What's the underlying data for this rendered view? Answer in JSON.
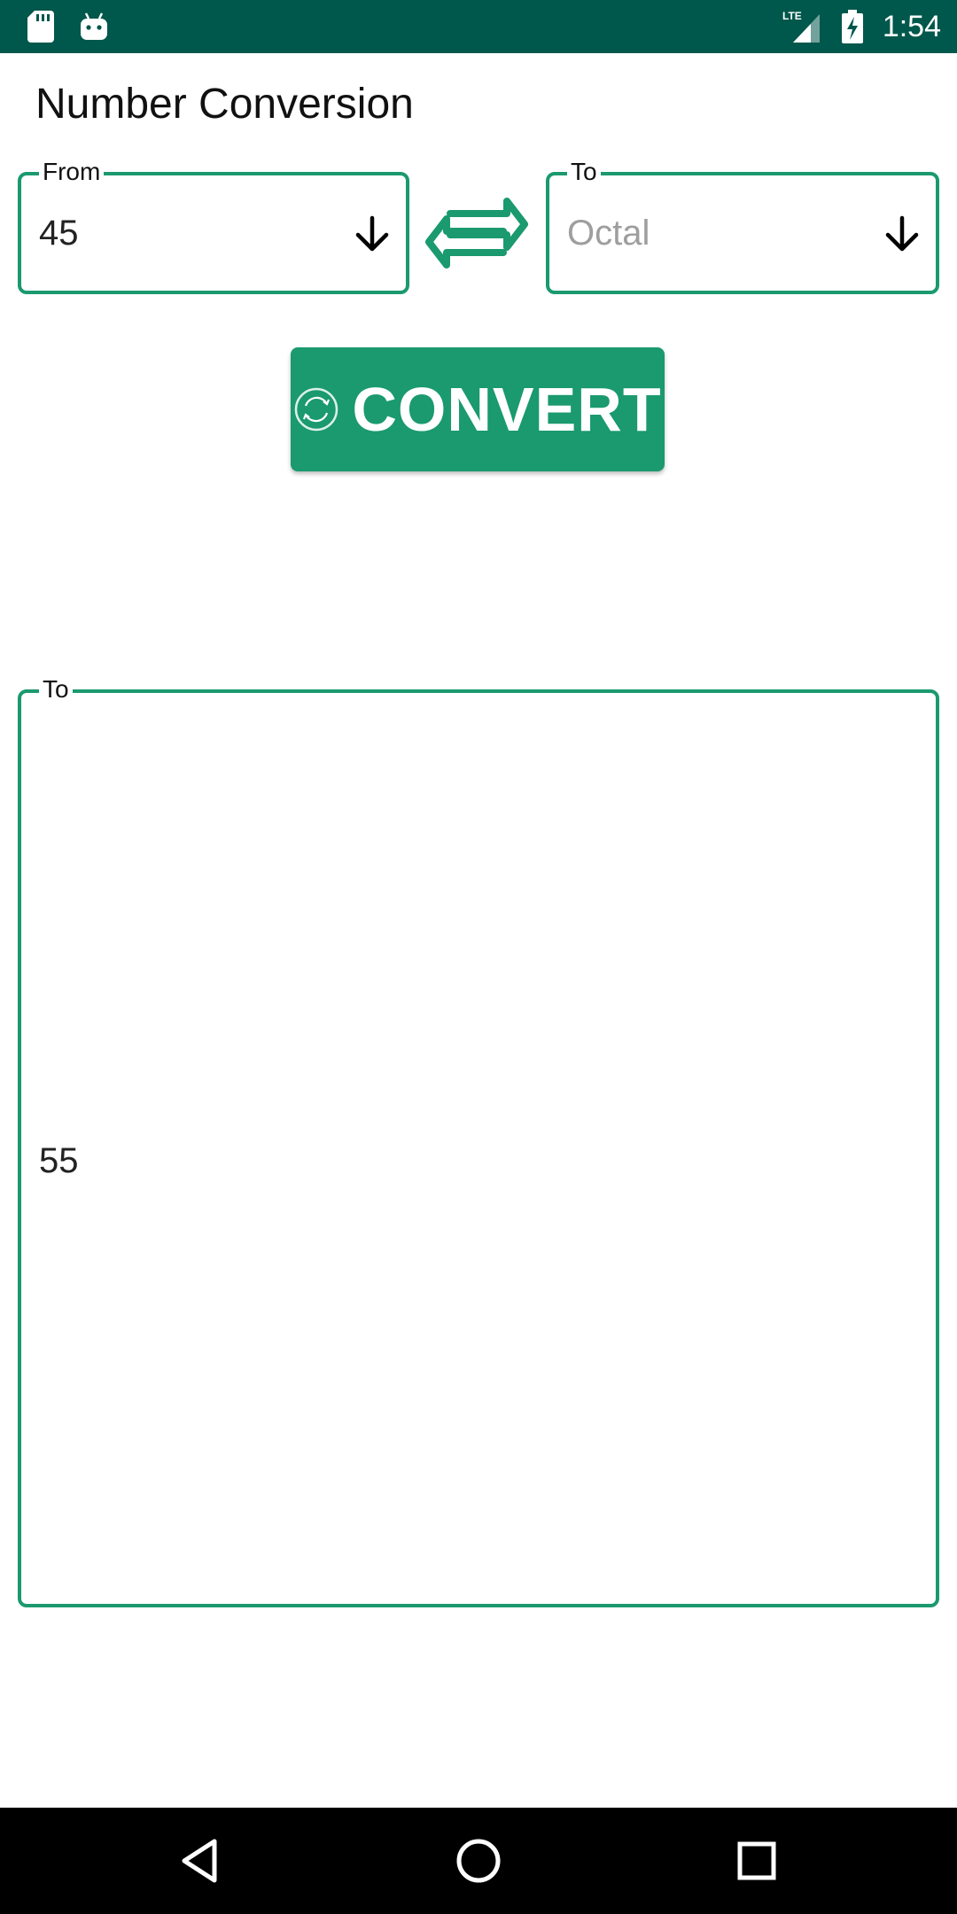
{
  "status_bar": {
    "time": "1:54",
    "network": "LTE",
    "icons": [
      "sd-card-icon",
      "android-icon",
      "lte-signal-icon",
      "battery-charging-icon"
    ]
  },
  "title": "Number Conversion",
  "from_field": {
    "legend": "From",
    "value": "45",
    "icon": "arrow-down-icon"
  },
  "to_field": {
    "legend": "To",
    "placeholder": "Octal",
    "icon": "arrow-down-icon"
  },
  "swap": {
    "icon": "swap-arrows-icon"
  },
  "convert_button": {
    "label": "CONVERT",
    "icon": "refresh-icon"
  },
  "result": {
    "legend": "To",
    "value": "55"
  },
  "nav_bar": {
    "icons": [
      "back-icon",
      "home-icon",
      "recents-icon"
    ]
  },
  "colors": {
    "accent": "#1a9a6e",
    "status_bar": "#00574b",
    "nav_bar": "#000000",
    "placeholder": "#9e9e9e"
  }
}
